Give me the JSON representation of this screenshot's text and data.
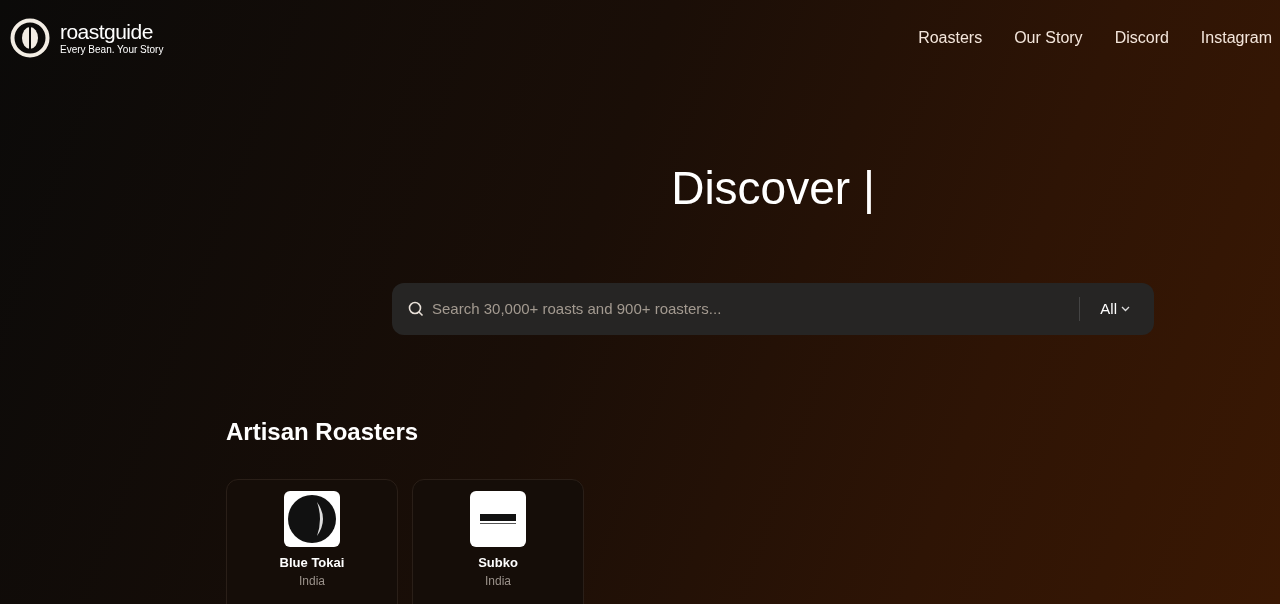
{
  "brand": {
    "name": "roastguide",
    "tagline": "Every Bean. Your Story"
  },
  "nav": [
    {
      "label": "Roasters"
    },
    {
      "label": "Our Story"
    },
    {
      "label": "Discord"
    },
    {
      "label": "Instagram"
    }
  ],
  "hero": {
    "title": "Discover |"
  },
  "search": {
    "placeholder": "Search 30,000+ roasts and 900+ roasters...",
    "filter": "All"
  },
  "section": {
    "title": "Artisan Roasters",
    "roasters": [
      {
        "name": "Blue Tokai",
        "country": "India",
        "kind": "dark"
      },
      {
        "name": "Subko",
        "country": "India",
        "kind": "light"
      }
    ]
  }
}
